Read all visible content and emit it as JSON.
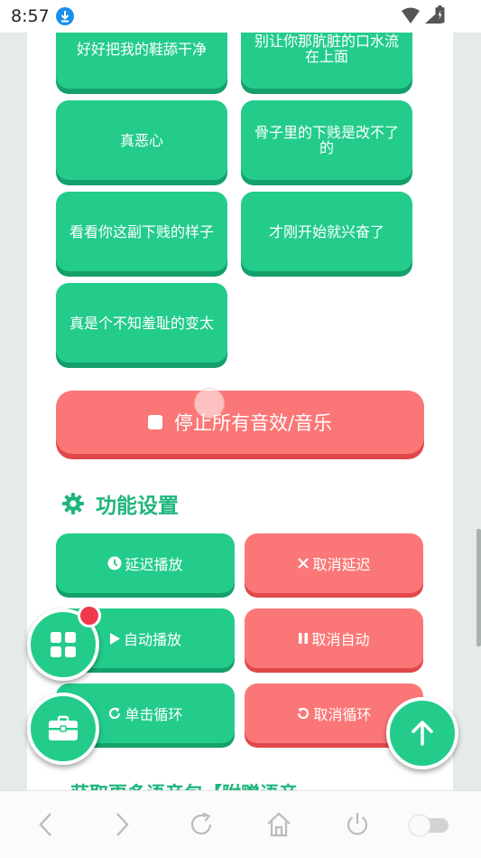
{
  "status_bar": {
    "time": "8:57"
  },
  "phrases": [
    "好好把我的鞋舔干净",
    "别让你那肮脏的口水流在上面",
    "真恶心",
    "骨子里的下贱是改不了的",
    "看看你这副下贱的样子",
    "才刚开始就兴奋了",
    "真是个不知羞耻的变太"
  ],
  "stop_button": {
    "label": "停止所有音效/音乐"
  },
  "settings": {
    "title": "功能设置",
    "buttons": [
      {
        "label": "延迟播放",
        "icon": "clock-icon"
      },
      {
        "label": "取消延迟",
        "icon": "close-icon"
      },
      {
        "label": "自动播放",
        "icon": "play-icon"
      },
      {
        "label": "取消自动",
        "icon": "pause-icon"
      },
      {
        "label": "单击循环",
        "icon": "redo-icon"
      },
      {
        "label": "取消循环",
        "icon": "undo-icon"
      }
    ]
  },
  "next_section": {
    "title_partial": "获取更多语音包【附赠语音"
  },
  "colors": {
    "green": "#23cc8b",
    "red": "#fb7777",
    "section_title": "#1fb67d",
    "badge": "#f0394d"
  }
}
